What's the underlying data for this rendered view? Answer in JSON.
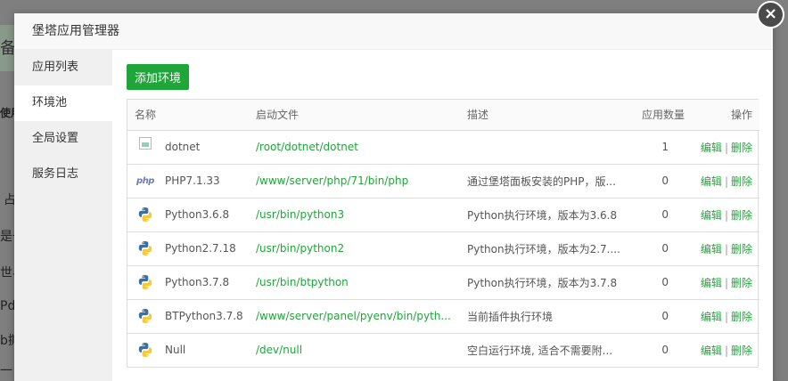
{
  "modal": {
    "title": "堡塔应用管理器",
    "close_icon": "×"
  },
  "background_fragments": [
    "备",
    "使用",
    "占",
    "是一",
    "世界",
    "Pd是",
    "b撕",
    "一"
  ],
  "sidebar": {
    "items": [
      {
        "label": "应用列表",
        "active": false
      },
      {
        "label": "环境池",
        "active": true
      },
      {
        "label": "全局设置",
        "active": false
      },
      {
        "label": "服务日志",
        "active": false
      }
    ]
  },
  "toolbar": {
    "add_label": "添加环境"
  },
  "table": {
    "headers": {
      "name": "名称",
      "file": "启动文件",
      "desc": "描述",
      "count": "应用数量",
      "op": "操作"
    },
    "rows": [
      {
        "icon": "broken-image-icon",
        "name": "dotnet",
        "file": "/root/dotnet/dotnet",
        "desc": "",
        "count": "1",
        "edit": "编辑",
        "del": "删除"
      },
      {
        "icon": "php-icon",
        "name": "PHP7.1.33",
        "file": "/www/server/php/71/bin/php",
        "desc": "通过堡塔面板安装的PHP，版...",
        "count": "0",
        "edit": "编辑",
        "del": "删除"
      },
      {
        "icon": "python-icon",
        "name": "Python3.6.8",
        "file": "/usr/bin/python3",
        "desc": "Python执行环境，版本为3.6.8",
        "count": "0",
        "edit": "编辑",
        "del": "删除"
      },
      {
        "icon": "python-icon",
        "name": "Python2.7.18",
        "file": "/usr/bin/python2",
        "desc": "Python执行环境，版本为2.7....",
        "count": "0",
        "edit": "编辑",
        "del": "删除"
      },
      {
        "icon": "python-icon",
        "name": "Python3.7.8",
        "file": "/usr/bin/btpython",
        "desc": "Python执行环境，版本为3.7.8",
        "count": "0",
        "edit": "编辑",
        "del": "删除"
      },
      {
        "icon": "python-icon",
        "name": "BTPython3.7.8",
        "file": "/www/server/panel/pyenv/bin/pyth...",
        "desc": "当前插件执行环境",
        "count": "0",
        "edit": "编辑",
        "del": "删除"
      },
      {
        "icon": "python-icon",
        "name": "Null",
        "file": "/dev/null",
        "desc": "空白运行环境, 适合不需要附...",
        "count": "0",
        "edit": "编辑",
        "del": "删除"
      }
    ],
    "separator": "|"
  },
  "colors": {
    "accent": "#20a53a",
    "python_blue": "#3772a4",
    "python_yellow": "#f7c93e",
    "php_purple": "#6b7eb2"
  }
}
